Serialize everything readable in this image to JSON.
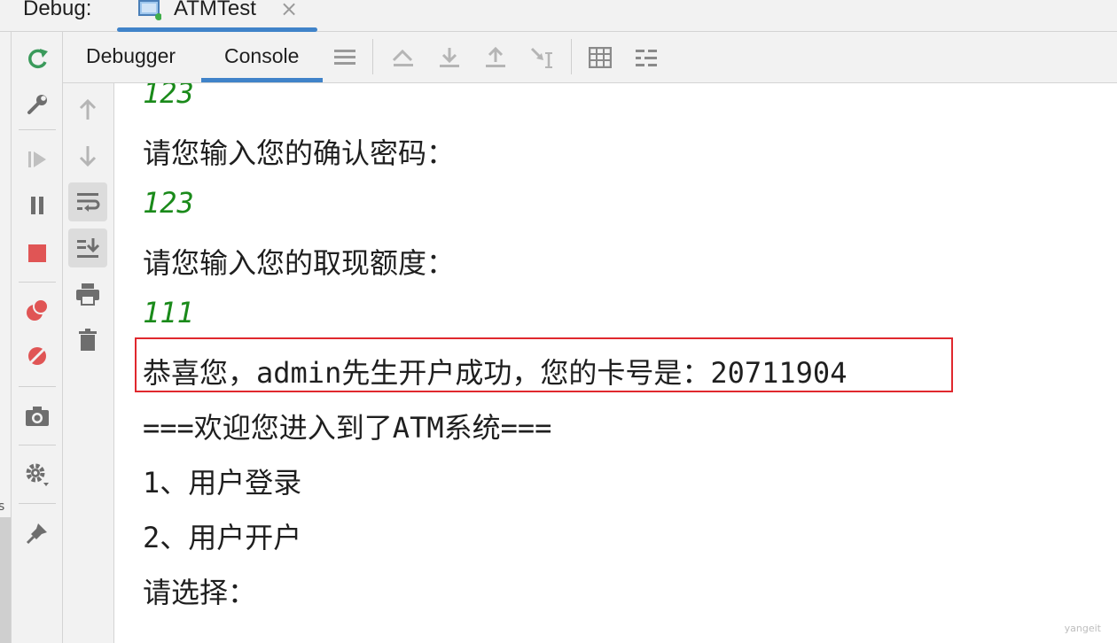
{
  "titlebar": {
    "debug_label": "Debug:",
    "tab_title": "ATMTest",
    "close_glyph": "×"
  },
  "header": {
    "tabs": [
      {
        "label": "Debugger"
      },
      {
        "label": "Console"
      }
    ],
    "active_tab": "Console"
  },
  "console": {
    "lines": [
      {
        "text": "123",
        "kind": "input"
      },
      {
        "text": "请您输入您的确认密码：",
        "kind": "output"
      },
      {
        "text": "123",
        "kind": "input"
      },
      {
        "text": "请您输入您的取现额度：",
        "kind": "output"
      },
      {
        "text": "111",
        "kind": "input"
      },
      {
        "text": "恭喜您，admin先生开户成功，您的卡号是：20711904",
        "kind": "output"
      },
      {
        "text": "===欢迎您进入到了ATM系统===",
        "kind": "output"
      },
      {
        "text": "1、用户登录",
        "kind": "output"
      },
      {
        "text": "2、用户开户",
        "kind": "output"
      },
      {
        "text": "请选择：",
        "kind": "output"
      }
    ]
  },
  "left_edge": {
    "mini_text": "s"
  },
  "watermark": "yangeit",
  "colors": {
    "accent": "#4083c9",
    "input_text": "#1a8a1a",
    "highlight": "#e0282e",
    "stop_red": "#e05555",
    "rerun_green": "#3a9a5b"
  },
  "icons": {
    "actionbar": [
      "rerun-icon",
      "settings-wrench-icon",
      "resume-icon",
      "pause-icon",
      "stop-icon",
      "view-breakpoints-icon",
      "mute-breakpoints-icon",
      "camera-icon",
      "gear-icon",
      "pin-icon"
    ],
    "header": [
      "menu-lines-icon",
      "step-over-icon",
      "step-into-icon",
      "step-out-icon",
      "run-to-cursor-icon",
      "evaluate-icon",
      "trace-icon"
    ],
    "sidebar": [
      "up-arrow-icon",
      "down-arrow-icon",
      "soft-wrap-icon",
      "scroll-to-end-icon",
      "print-icon",
      "trash-icon"
    ]
  }
}
